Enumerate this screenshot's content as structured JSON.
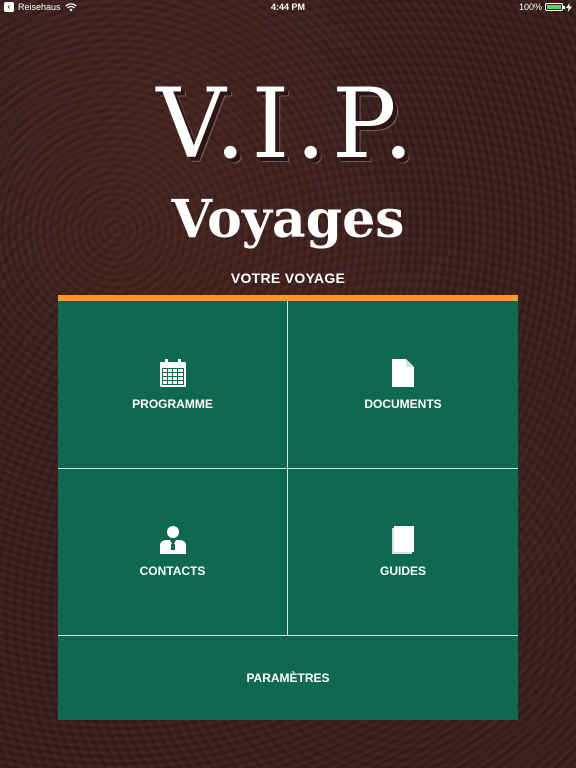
{
  "status_bar": {
    "back_app": "Reisehaus",
    "time": "4:44 PM",
    "battery": "100%",
    "battery_level": 1.0
  },
  "logo": {
    "line1": "V.I.P.",
    "line2": "Voyages"
  },
  "section_title": "VOTRE VOYAGE",
  "menu": {
    "programme": "PROGRAMME",
    "documents": "DOCUMENTS",
    "contacts": "CONTACTS",
    "guides": "GUIDES",
    "parametres": "PARAMÈTRES"
  },
  "icons": {
    "programme": "calendar-icon",
    "documents": "document-icon",
    "contacts": "person-icon",
    "guides": "book-icon"
  },
  "colors": {
    "panel": "#0e694e",
    "accent": "#f39a2b",
    "background": "#3a1f1c"
  }
}
